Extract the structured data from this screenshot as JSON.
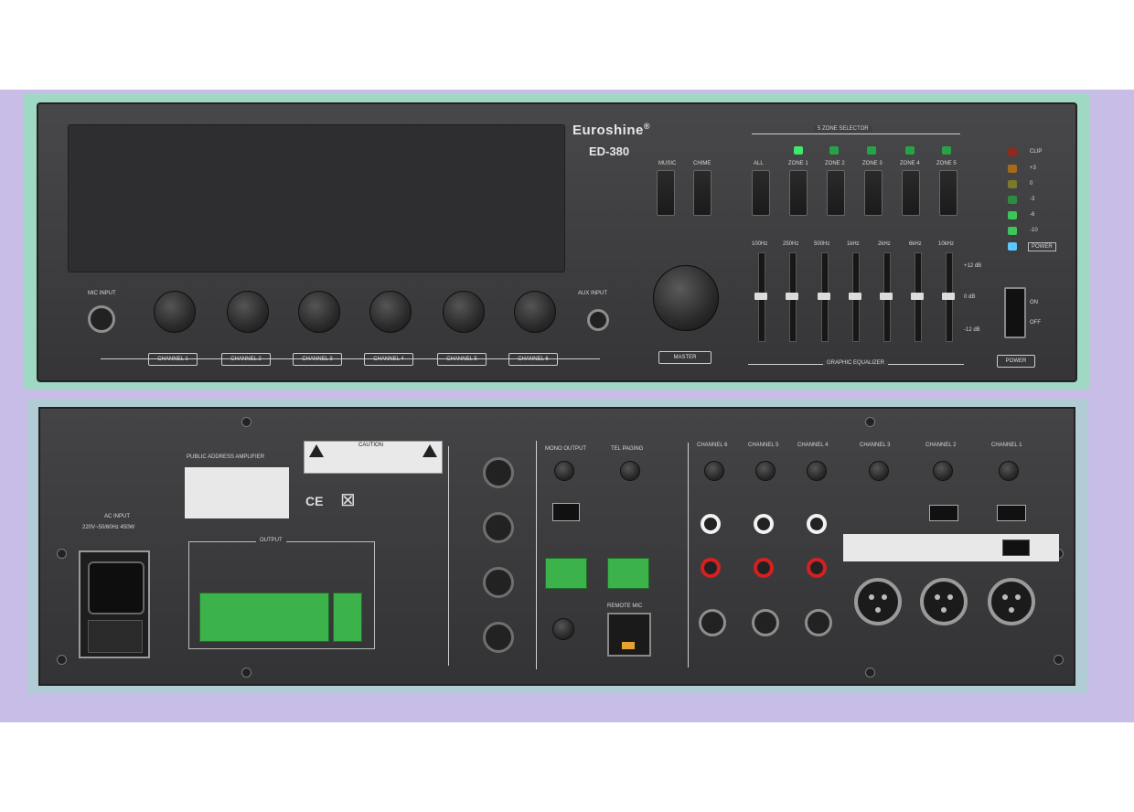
{
  "brand": "Euroshine",
  "brand_mark": "®",
  "model": "ED-380",
  "front": {
    "mic_input_label": "MIC INPUT",
    "aux_input_label": "AUX INPUT",
    "channel_labels": [
      "CHANNEL 1",
      "CHANNEL 2",
      "CHANNEL 3",
      "CHANNEL 4",
      "CHANNEL 5",
      "CHANNEL 6"
    ],
    "master_label": "MASTER",
    "zone_selector_label": "5 ZONE SELECTOR",
    "zone_buttons": [
      "ALL",
      "ZONE 1",
      "ZONE 2",
      "ZONE 3",
      "ZONE 4",
      "ZONE 5"
    ],
    "mode_buttons": [
      "MUSIC",
      "CHIME"
    ],
    "eq_bands": [
      "100Hz",
      "250Hz",
      "500Hz",
      "1kHz",
      "2kHz",
      "6kHz",
      "10kHz"
    ],
    "eq_scale": [
      "+12 dB",
      "0 dB",
      "-12 dB"
    ],
    "eq_label": "GRAPHIC EQUALIZER",
    "meter_labels": [
      "CLIP",
      "+3",
      "0",
      "-3",
      "-6",
      "-10",
      "POWER"
    ],
    "power_label": "POWER",
    "power_switch_labels": [
      "ON",
      "OFF"
    ]
  },
  "rear": {
    "ac_input_label": "AC INPUT",
    "ac_input_spec": "220V~50/60Hz 450W",
    "pa_label": "PUBLIC ADDRESS AMPLIFIER",
    "output_label": "OUTPUT",
    "warning_title": "CAUTION",
    "mono_out_label": "MONO OUTPUT",
    "tel_paging_label": "TEL PAGING",
    "remote_mic_label": "REMOTE MIC",
    "channels": [
      "CHANNEL 6",
      "CHANNEL 5",
      "CHANNEL 4",
      "CHANNEL 3",
      "CHANNEL 2",
      "CHANNEL 1"
    ]
  },
  "colors": {
    "frame": "#c8bde6",
    "glow": "#9fd9c4",
    "panel": "#3b3b3d",
    "terminal_green": "#3cb34a",
    "rca_white": "#f2f2f2",
    "rca_red": "#d42020"
  }
}
